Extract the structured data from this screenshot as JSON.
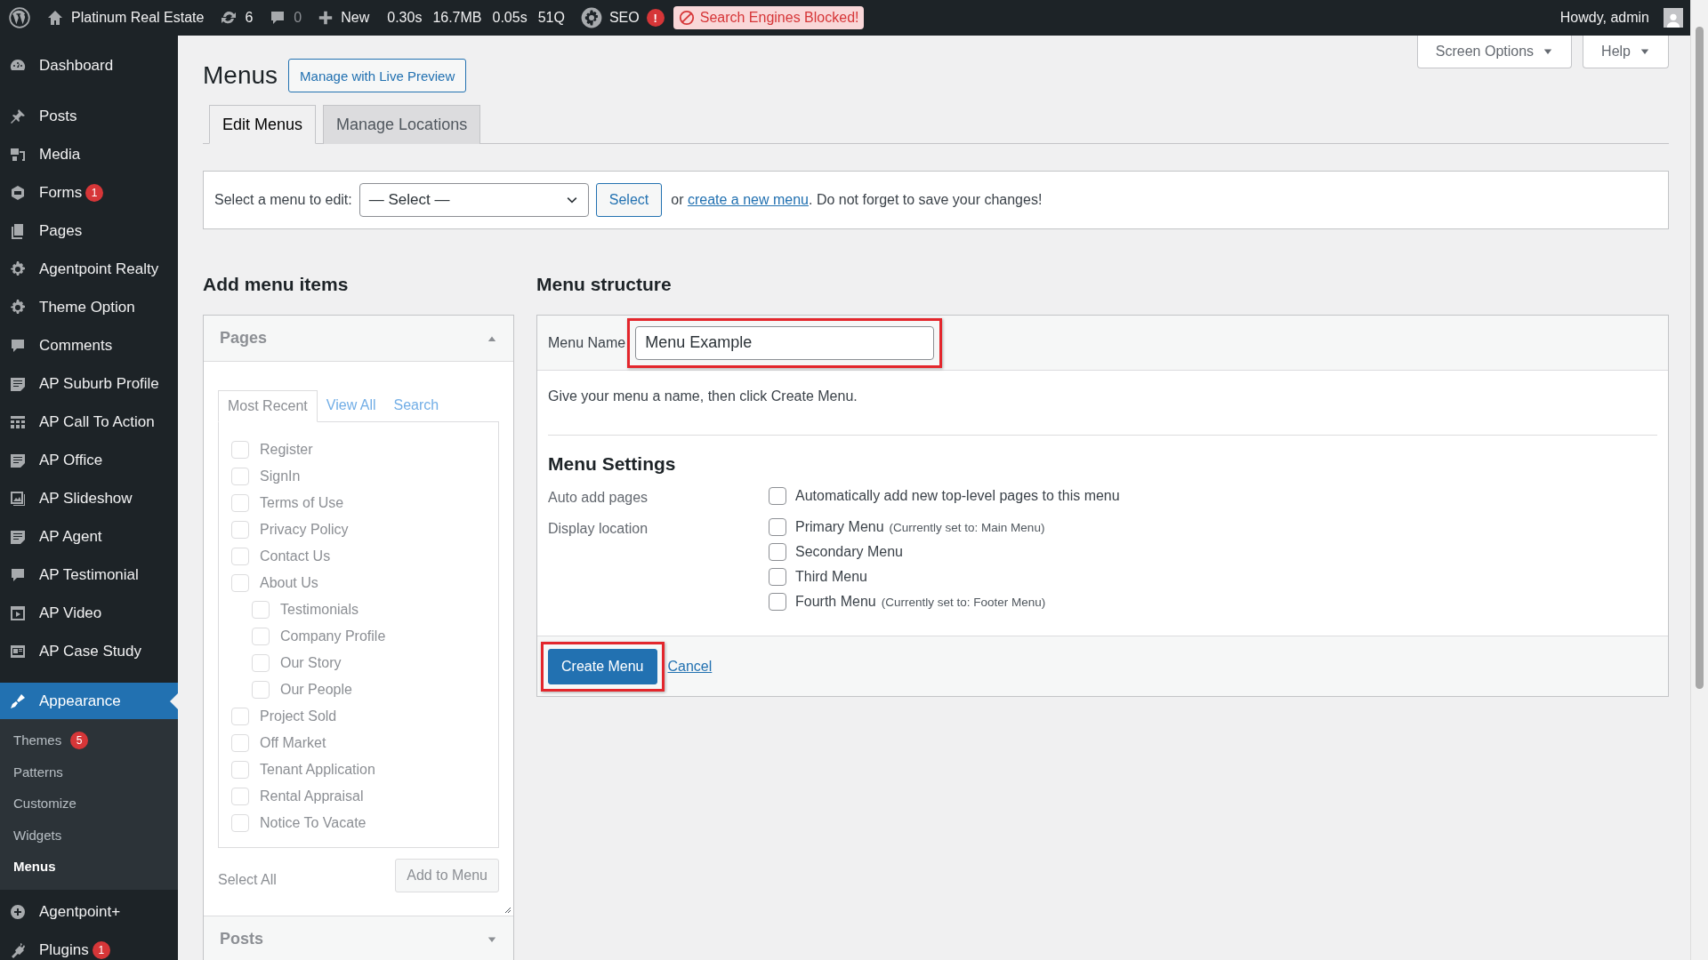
{
  "admin_bar": {
    "site_name": "Platinum Real Estate",
    "updates": "6",
    "comments": "0",
    "new_label": "New",
    "stats": [
      "0.30s",
      "16.7MB",
      "0.05s",
      "51Q"
    ],
    "seo_label": "SEO",
    "seo_badge": "!",
    "notice": "Search Engines Blocked!",
    "greeting": "Howdy, admin"
  },
  "sidebar": {
    "items": [
      {
        "label": "Dashboard",
        "selected": false
      },
      {
        "label": "Posts",
        "selected": false
      },
      {
        "label": "Media",
        "selected": false
      },
      {
        "label": "Forms",
        "badge": "1",
        "selected": false
      },
      {
        "label": "Pages",
        "selected": false
      },
      {
        "label": "Agentpoint Realty",
        "selected": false
      },
      {
        "label": "Theme Option",
        "selected": false
      },
      {
        "label": "Comments",
        "selected": false
      },
      {
        "label": "AP Suburb Profile",
        "selected": false
      },
      {
        "label": "AP Call To Action",
        "selected": false
      },
      {
        "label": "AP Office",
        "selected": false
      },
      {
        "label": "AP Slideshow",
        "selected": false
      },
      {
        "label": "AP Agent",
        "selected": false
      },
      {
        "label": "AP Testimonial",
        "selected": false
      },
      {
        "label": "AP Video",
        "selected": false
      },
      {
        "label": "AP Case Study",
        "selected": false
      },
      {
        "label": "Appearance",
        "selected": true,
        "children": [
          {
            "label": "Themes",
            "badge": "5",
            "selected": false
          },
          {
            "label": "Patterns",
            "selected": false
          },
          {
            "label": "Customize",
            "selected": false
          },
          {
            "label": "Widgets",
            "selected": false
          },
          {
            "label": "Menus",
            "selected": true
          }
        ]
      },
      {
        "label": "Agentpoint+",
        "selected": false
      },
      {
        "label": "Plugins",
        "badge": "1",
        "selected": false
      }
    ]
  },
  "screen_tabs": [
    "Screen Options",
    "Help"
  ],
  "page_title": "Menus",
  "live_preview_button": "Manage with Live Preview",
  "tabs": [
    {
      "label": "Edit Menus",
      "selected": true
    },
    {
      "label": "Manage Locations",
      "selected": false
    }
  ],
  "select_bar": {
    "label": "Select a menu to edit:",
    "dropdown": "— Select —",
    "button": "Select",
    "text_before": "or ",
    "link": "create a new menu",
    "text_after": ". Do not forget to save your changes!"
  },
  "add_items": {
    "heading": "Add menu items",
    "disabled": true,
    "sections": [
      {
        "title": "Pages",
        "expanded": true,
        "tabs": [
          {
            "label": "Most Recent",
            "selected": true
          },
          {
            "label": "View All",
            "selected": false
          },
          {
            "label": "Search",
            "selected": false
          }
        ],
        "items": [
          {
            "label": "Register",
            "checked": false
          },
          {
            "label": "SignIn",
            "checked": false
          },
          {
            "label": "Terms of Use",
            "checked": false
          },
          {
            "label": "Privacy Policy",
            "checked": false
          },
          {
            "label": "Contact Us",
            "checked": false
          },
          {
            "label": "About Us",
            "checked": false,
            "children": [
              {
                "label": "Testimonials",
                "checked": false
              },
              {
                "label": "Company Profile",
                "checked": false
              },
              {
                "label": "Our Story",
                "checked": false
              },
              {
                "label": "Our People",
                "checked": false
              }
            ]
          },
          {
            "label": "Project Sold",
            "checked": false
          },
          {
            "label": "Off Market",
            "checked": false
          },
          {
            "label": "Tenant Application",
            "checked": false
          },
          {
            "label": "Rental Appraisal",
            "checked": false
          },
          {
            "label": "Notice To Vacate",
            "checked": false
          }
        ],
        "select_all": "Select All",
        "add_button": "Add to Menu"
      },
      {
        "title": "Posts",
        "expanded": false
      }
    ]
  },
  "structure": {
    "heading": "Menu structure",
    "menu_name": {
      "label": "Menu Name",
      "value": "Menu Example",
      "highlighted": true
    },
    "instructions": "Give your menu a name, then click Create Menu.",
    "settings_heading": "Menu Settings",
    "settings": [
      {
        "label": "Auto add pages",
        "options": [
          {
            "text": "Automatically add new top-level pages to this menu",
            "checked": false
          }
        ]
      },
      {
        "label": "Display location",
        "options": [
          {
            "text": "Primary Menu",
            "note": "(Currently set to: Main Menu)",
            "checked": false
          },
          {
            "text": "Secondary Menu",
            "checked": false
          },
          {
            "text": "Third Menu",
            "checked": false
          },
          {
            "text": "Fourth Menu",
            "note": "(Currently set to: Footer Menu)",
            "checked": false
          }
        ]
      }
    ],
    "create_button": {
      "label": "Create Menu",
      "highlighted": true
    },
    "cancel": "Cancel"
  }
}
